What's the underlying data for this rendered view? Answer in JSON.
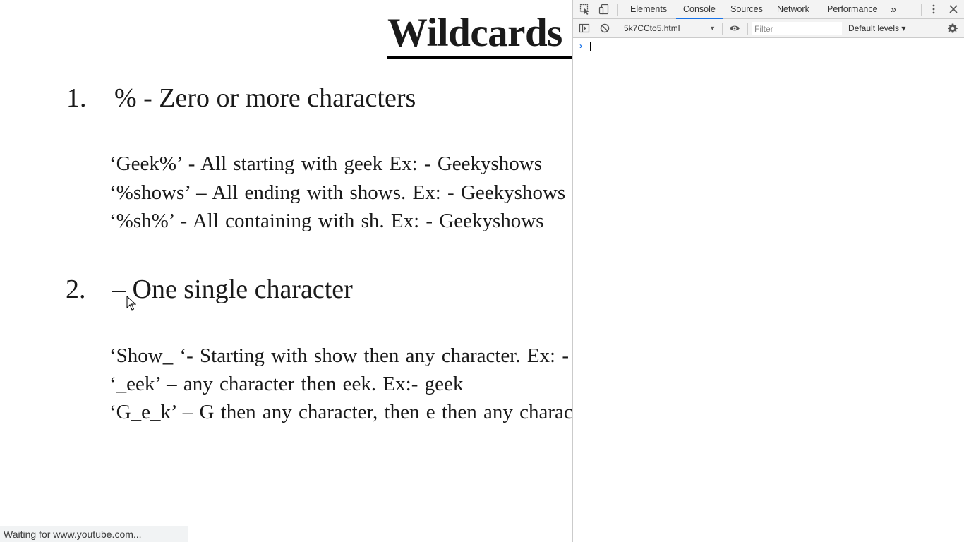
{
  "slide": {
    "title": "Wildcards",
    "section1": {
      "number": "1.",
      "heading": "%  -  Zero or more characters",
      "lines": [
        "‘Geek%’  - All starting with geek Ex: - Geekyshows",
        "‘%shows’ – All ending with shows. Ex: - Geekyshows",
        "‘%sh%’ - All containing with sh. Ex: - Geekyshows"
      ]
    },
    "section2": {
      "number": "2.",
      "heading": "– One single character",
      "lines": [
        "‘Show_ ‘- Starting with show then any character.  Ex: -",
        "‘_eek’ – any character then eek. Ex:-  geek",
        "‘G_e_k’ – G then any character, then e then any character"
      ]
    }
  },
  "status_bar": {
    "text": "Waiting for www.youtube.com..."
  },
  "devtools": {
    "tabs": [
      "Elements",
      "Console",
      "Sources",
      "Network",
      "Performance"
    ],
    "active_tab": "Console",
    "more_tabs_label": "»",
    "context": "5k7CCto5.html",
    "filter_placeholder": "Filter",
    "levels_label": "Default levels ▾",
    "prompt_symbol": "›",
    "accent_color": "#1a73e8"
  },
  "icons": [
    "inspect-element-icon",
    "device-toolbar-icon",
    "more-tabs-icon",
    "kebab-menu-icon",
    "close-icon",
    "sidebar-toggle-icon",
    "clear-console-icon",
    "live-expression-eye-icon",
    "settings-gear-icon",
    "mouse-cursor-icon"
  ]
}
